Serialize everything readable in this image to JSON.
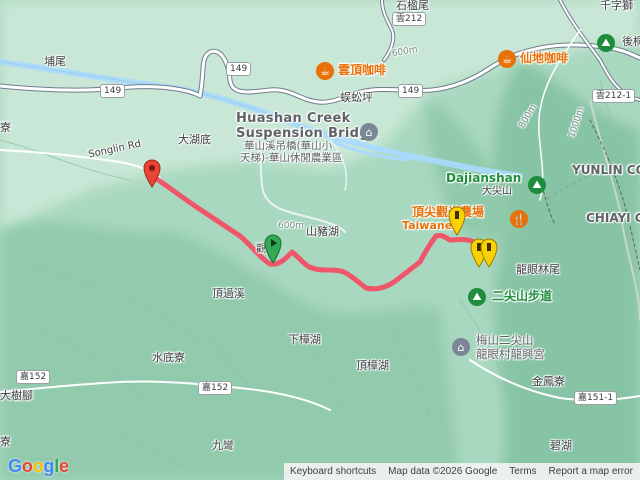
{
  "labels": {
    "shihwei": "石楹尾",
    "qianshi": "千字獅",
    "houma": "後桐",
    "pinwei": "埔尾",
    "yunding_cafe": "雲頂咖啡",
    "xiandi_cafe": "仙地咖啡",
    "wuzha": "蜈蚣坪",
    "huashan_en_1": "Huashan Creek",
    "huashan_en_2": "Suspension Bridge",
    "huashan_zh_1": "華山溪吊橋(華山小",
    "huashan_zh_2": "天梯)-華山休閒農業區",
    "dahudi": "大湖底",
    "songlin_rd": "Songlin Rd",
    "liao": "寮",
    "dajianshan_en": "Dajianshan",
    "dajianshan_zh": "大尖山",
    "yunlin": "YUNLIN CO",
    "chiayi": "CHIAYI C",
    "shanzhuhu": "山豬湖",
    "dingjian": "頂尖觀光農場",
    "taiwanese": "Taiwanes",
    "longyanlinwei": "龍眼林尾",
    "erjianshan_trail": "二尖山步道",
    "dingguoxi": "頂過溪",
    "xiazhanghu": "下樟湖",
    "meishan_temple_1": "梅山二尖山",
    "meishan_temple_2": "龍眼村龍興宮",
    "shuidiliao": "水底寮",
    "dingzhanghu": "頂樟湖",
    "jinfengliao": "金鳳寮",
    "dashujiao": "大樹腳",
    "jiuwan": "九彎",
    "bihu": "碧湖",
    "start_label": "觀"
  },
  "shields": {
    "r149_a": "149",
    "r149_b": "149",
    "r149_c": "149",
    "yun212_a": "雲212",
    "yun212_b": "雲212-1",
    "jia152_a": "嘉152",
    "jia152_b": "嘉152",
    "jia151": "嘉151-1"
  },
  "contours": {
    "c600_a": "600m",
    "c600_b": "600m",
    "c800": "800m",
    "c1000": "1000m"
  },
  "attribution": {
    "logo": "Google",
    "shortcuts": "Keyboard shortcuts",
    "map_data": "Map data ©2026 Google",
    "terms": "Terms",
    "report": "Report a map error"
  },
  "colors": {
    "track": "#f0566a",
    "terrain": "#a7d7bd",
    "river": "#aadaff",
    "road": "#ffffff",
    "start_marker": "#34a853",
    "end_marker": "#ea4335",
    "waypoint_marker": "#fbd104"
  }
}
